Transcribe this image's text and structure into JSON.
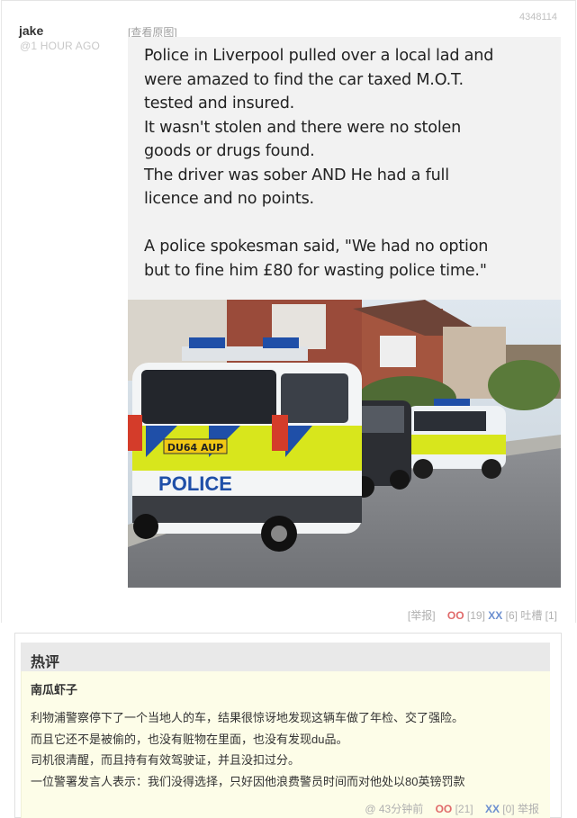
{
  "post": {
    "author": "jake",
    "time": "@1 HOUR AGO",
    "id": "4348114",
    "view_original": "[查看原图]",
    "image_text": {
      "para1": [
        "Police in Liverpool pulled over a local lad and",
        "were amazed to find the car taxed M.O.T.",
        "tested and insured.",
        "It wasn't stolen and there were no stolen",
        "goods or drugs found.",
        "The driver was sober AND He had a full",
        "licence and no points."
      ],
      "para2": [
        "A police spokesman said, \"We had no option",
        "but to fine him £80 for wasting police time.\""
      ],
      "plate": "DU64 AUP",
      "car_label": "POLICE"
    },
    "actions": {
      "report": "[举报]",
      "oo": "OO",
      "oo_count": "[19]",
      "xx": "XX",
      "xx_count": "[6]",
      "tucao": "吐槽 [1]"
    }
  },
  "hot_comments": {
    "title": "热评",
    "comment": {
      "author": "南瓜虾子",
      "lines": [
        "利物浦警察停下了一个当地人的车，结果很惊讶地发现这辆车做了年检、交了强险。",
        "而且它还不是被偷的，也没有赃物在里面，也没有发现du品。",
        "司机很清醒，而且持有有效驾驶证，并且没扣过分。",
        "一位警署发言人表示：我们没得选择，只好因他浪费警员时间而对他处以80英镑罚款"
      ],
      "time": "@ 43分钟前",
      "oo": "OO",
      "oo_count": "[21]",
      "xx": "XX",
      "xx_count": "[0]",
      "report": "举报"
    }
  },
  "colors": {
    "oo": "#e06a6a",
    "xx": "#6c8fd0",
    "hot_bg": "#fdfde8",
    "hot_head_bg": "#e9e9e9",
    "police_yellow": "#d8e61c",
    "police_blue": "#1f4fa8"
  }
}
